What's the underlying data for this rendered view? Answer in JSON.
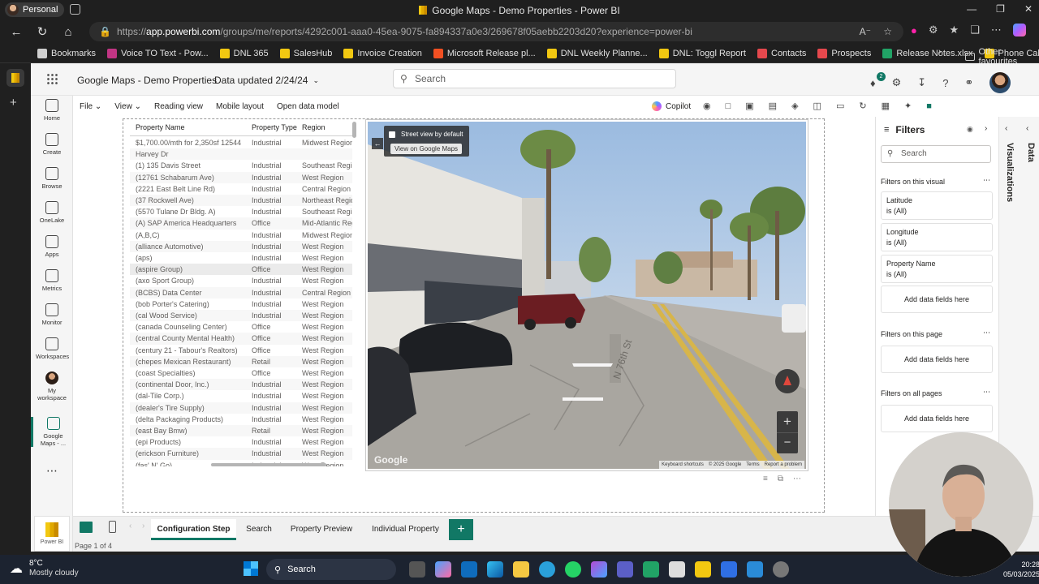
{
  "browser": {
    "profile": "Personal",
    "window_title": "Google Maps - Demo Properties - Power BI",
    "url_prefix": "https://",
    "url_host": "app.powerbi.com",
    "url_path": "/groups/me/reports/4292c001-aaa0-45ea-9075-fa894337a0e3/269678f05aebb2203d20?experience=power-bi",
    "bookmarks": [
      {
        "label": "Bookmarks",
        "color": "#cfcfcf"
      },
      {
        "label": "Voice TO Text - Pow...",
        "color": "#c13584"
      },
      {
        "label": "DNL 365",
        "color": "#f2c811"
      },
      {
        "label": "SalesHub",
        "color": "#f2c811"
      },
      {
        "label": "Invoice Creation",
        "color": "#f2c811"
      },
      {
        "label": "Microsoft Release pl...",
        "color": "#f25022"
      },
      {
        "label": "DNL Weekly Planne...",
        "color": "#f2c811"
      },
      {
        "label": "DNL: Toggl Report",
        "color": "#f2c811"
      },
      {
        "label": "Contacts",
        "color": "#e5484d"
      },
      {
        "label": "Prospects",
        "color": "#e5484d"
      },
      {
        "label": "Release Notes.xlsx",
        "color": "#21a366"
      },
      {
        "label": "Phone Call: T-Form:...",
        "color": "#f2c811"
      }
    ],
    "other_favourites": "Other favourites"
  },
  "header": {
    "report_title": "Google Maps - Demo Properties",
    "data_updated": "Data updated 2/24/24",
    "search_placeholder": "Search",
    "notification_count": "2"
  },
  "ribbon": {
    "file": "File",
    "view": "View",
    "reading_view": "Reading view",
    "mobile_layout": "Mobile layout",
    "open_data_model": "Open data model",
    "copilot": "Copilot"
  },
  "leftnav": [
    {
      "label": "Home"
    },
    {
      "label": "Create"
    },
    {
      "label": "Browse"
    },
    {
      "label": "OneLake"
    },
    {
      "label": "Apps"
    },
    {
      "label": "Metrics"
    },
    {
      "label": "Monitor"
    },
    {
      "label": "Workspaces"
    },
    {
      "label": "My workspace"
    },
    {
      "label": "Google Maps - ..."
    }
  ],
  "table": {
    "columns": [
      "Property Name",
      "Property Type",
      "Region"
    ],
    "rows": [
      [
        "$1,700.00/mth for 2,350sf 12544",
        "Industrial",
        "Midwest Region"
      ],
      [
        "Harvey Dr",
        "",
        ""
      ],
      [
        "(1) 135 Davis Street",
        "Industrial",
        "Southeast Region"
      ],
      [
        "(12761 Schabarum Ave)",
        "Industrial",
        "West Region"
      ],
      [
        "(2221 East Belt Line Rd)",
        "Industrial",
        "Central Region"
      ],
      [
        "(37 Rockwell Ave)",
        "Industrial",
        "Northeast Region"
      ],
      [
        "(5570 Tulane Dr Bldg. A)",
        "Industrial",
        "Southeast Region"
      ],
      [
        "(A) SAP America Headquarters",
        "Office",
        "Mid-Atlantic Region"
      ],
      [
        "(A,B,C)",
        "Industrial",
        "Midwest Region"
      ],
      [
        "(alliance Automotive)",
        "Industrial",
        "West Region"
      ],
      [
        "(aps)",
        "Industrial",
        "West Region"
      ],
      [
        "(aspire Group)",
        "Office",
        "West Region"
      ],
      [
        "(axo Sport Group)",
        "Industrial",
        "West Region"
      ],
      [
        "(BCBS) Data Center",
        "Industrial",
        "Central Region"
      ],
      [
        "(bob Porter's Catering)",
        "Industrial",
        "West Region"
      ],
      [
        "(cal Wood Service)",
        "Industrial",
        "West Region"
      ],
      [
        "(canada Counseling Center)",
        "Office",
        "West Region"
      ],
      [
        "(central County Mental Health)",
        "Office",
        "West Region"
      ],
      [
        "(century 21 - Tabour's Realtors)",
        "Office",
        "West Region"
      ],
      [
        "(chepes Mexican Restaurant)",
        "Retail",
        "West Region"
      ],
      [
        "(coast Specialties)",
        "Office",
        "West Region"
      ],
      [
        "(continental Door, Inc.)",
        "Industrial",
        "West Region"
      ],
      [
        "(dal-Tile Corp.)",
        "Industrial",
        "West Region"
      ],
      [
        "(dealer's Tire Supply)",
        "Industrial",
        "West Region"
      ],
      [
        "(delta Packaging Products)",
        "Industrial",
        "West Region"
      ],
      [
        "(east Bay Bmw)",
        "Retail",
        "West Region"
      ],
      [
        "(epi Products)",
        "Industrial",
        "West Region"
      ],
      [
        "(erickson Furniture)",
        "Industrial",
        "West Region"
      ],
      [
        "(fas' N' Go)",
        "Industrial",
        "West Region"
      ]
    ]
  },
  "map": {
    "street_view_default": "Street view by default",
    "view_on_google_maps": "View on Google Maps",
    "street_sign": "N 76th St",
    "attribution": [
      "Keyboard shortcuts",
      "© 2025 Google",
      "Terms",
      "Report a problem"
    ],
    "logo": "Google",
    "zoom_in": "+",
    "zoom_out": "−"
  },
  "filters": {
    "title": "Filters",
    "search_placeholder": "Search",
    "on_visual": "Filters on this visual",
    "cards": [
      {
        "name": "Latitude",
        "value": "is (All)"
      },
      {
        "name": "Longitude",
        "value": "is (All)"
      },
      {
        "name": "Property Name",
        "value": "is (All)"
      }
    ],
    "add_fields": "Add data fields here",
    "on_page": "Filters on this page",
    "on_all_pages": "Filters on all pages"
  },
  "panes": {
    "data": "Data",
    "visualizations": "Visualizations"
  },
  "pages": {
    "tabs": [
      "Configuration Step",
      "Search",
      "Property Preview",
      "Individual Property"
    ],
    "active": "Configuration Step",
    "add": "+",
    "page_indicator": "Page 1 of 4",
    "powerbi_label": "Power BI"
  },
  "taskbar": {
    "temperature": "8°C",
    "weather": "Mostly cloudy",
    "search": "Search",
    "time": "20:28",
    "date": "05/03/2025"
  }
}
